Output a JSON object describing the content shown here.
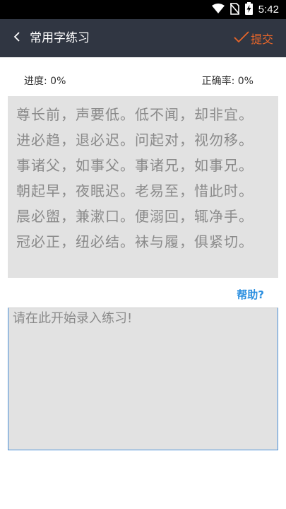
{
  "status_bar": {
    "time": "5:42",
    "icons": [
      "wifi-icon",
      "no-sim-icon",
      "battery-charging-icon"
    ]
  },
  "app_bar": {
    "back_icon": "chevron-left-icon",
    "title": "常用字练习",
    "submit_icon": "checkmark-icon",
    "submit_label": "提交"
  },
  "stats": {
    "progress_label": "进度: 0%",
    "accuracy_label": "正确率: 0%"
  },
  "reference_lines": [
    "尊长前，声要低。低不闻，却非宜。",
    "进必趋，退必迟。问起对，视勿移。",
    "事诸父，如事父。事诸兄，如事兄。",
    "朝起早，夜眠迟。老易至，惜此时。",
    "晨必盥，兼漱口。便溺回，辄净手。",
    "冠必正，纽必结。袜与履，俱紧切。"
  ],
  "help_label": "帮助?",
  "practice_input": {
    "value": "",
    "placeholder": "请在此开始录入练习!"
  },
  "colors": {
    "app_bar_bg": "#303642",
    "accent_orange": "#e8662a",
    "help_blue": "#2b8fe0",
    "panel_gray": "#e2e2e2"
  }
}
